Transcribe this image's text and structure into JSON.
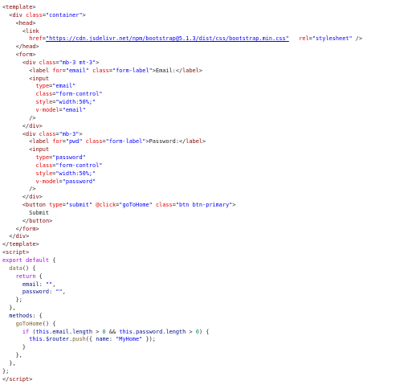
{
  "code_lines": [
    {
      "indent": 0,
      "tokens": [
        [
          "pun",
          "<"
        ],
        [
          "tag",
          "template"
        ],
        [
          "pun",
          ">"
        ]
      ]
    },
    {
      "indent": 1,
      "tokens": [
        [
          "pun",
          "<"
        ],
        [
          "tag",
          "div"
        ],
        [
          "pun",
          " "
        ],
        [
          "attr",
          "class"
        ],
        [
          "pun",
          "="
        ],
        [
          "str",
          "\"container\""
        ],
        [
          "pun",
          ">"
        ]
      ]
    },
    {
      "indent": 2,
      "tokens": [
        [
          "pun",
          "<"
        ],
        [
          "tag",
          "head"
        ],
        [
          "pun",
          ">"
        ]
      ]
    },
    {
      "indent": 3,
      "tokens": [
        [
          "pun",
          "<"
        ],
        [
          "tag",
          "link"
        ]
      ]
    },
    {
      "indent": 4,
      "tokens": [
        [
          "attr",
          "href"
        ],
        [
          "pun",
          "="
        ],
        [
          "url",
          "\"https://cdn.jsdelivr.net/npm/bootstrap@5.1.3/dist/css/bootstrap.min.css\""
        ],
        [
          "pun",
          "   "
        ],
        [
          "attr",
          "rel"
        ],
        [
          "pun",
          "="
        ],
        [
          "str",
          "\"stylesheet\""
        ],
        [
          "pun",
          " />"
        ]
      ]
    },
    {
      "indent": 2,
      "tokens": [
        [
          "pun",
          "</"
        ],
        [
          "tag",
          "head"
        ],
        [
          "pun",
          ">"
        ]
      ]
    },
    {
      "indent": 2,
      "tokens": [
        [
          "pun",
          "<"
        ],
        [
          "tag",
          "form"
        ],
        [
          "pun",
          ">"
        ]
      ]
    },
    {
      "indent": 3,
      "tokens": [
        [
          "pun",
          "<"
        ],
        [
          "tag",
          "div"
        ],
        [
          "pun",
          " "
        ],
        [
          "attr",
          "class"
        ],
        [
          "pun",
          "="
        ],
        [
          "str",
          "\"mb-3 mt-3\""
        ],
        [
          "pun",
          ">"
        ]
      ]
    },
    {
      "indent": 4,
      "tokens": [
        [
          "pun",
          "<"
        ],
        [
          "tag",
          "label"
        ],
        [
          "pun",
          " "
        ],
        [
          "attr",
          "for"
        ],
        [
          "pun",
          "="
        ],
        [
          "str",
          "\"email\""
        ],
        [
          "pun",
          " "
        ],
        [
          "attr",
          "class"
        ],
        [
          "pun",
          "="
        ],
        [
          "str",
          "\"form-label\""
        ],
        [
          "pun",
          ">"
        ],
        [
          "txt",
          "Email:"
        ],
        [
          "pun",
          "</"
        ],
        [
          "tag",
          "label"
        ],
        [
          "pun",
          ">"
        ]
      ]
    },
    {
      "indent": 4,
      "tokens": [
        [
          "pun",
          "<"
        ],
        [
          "tag",
          "input"
        ]
      ]
    },
    {
      "indent": 5,
      "tokens": [
        [
          "attr",
          "type"
        ],
        [
          "pun",
          "="
        ],
        [
          "str",
          "\"email\""
        ]
      ]
    },
    {
      "indent": 5,
      "tokens": [
        [
          "attr",
          "class"
        ],
        [
          "pun",
          "="
        ],
        [
          "str",
          "\"form-control\""
        ]
      ]
    },
    {
      "indent": 5,
      "tokens": [
        [
          "attr",
          "style"
        ],
        [
          "pun",
          "="
        ],
        [
          "str",
          "\"width:50%;\""
        ]
      ]
    },
    {
      "indent": 5,
      "tokens": [
        [
          "attr",
          "v-model"
        ],
        [
          "pun",
          "="
        ],
        [
          "str",
          "\"email\""
        ]
      ]
    },
    {
      "indent": 4,
      "tokens": [
        [
          "pun",
          "/>"
        ]
      ]
    },
    {
      "indent": 3,
      "tokens": [
        [
          "pun",
          "</"
        ],
        [
          "tag",
          "div"
        ],
        [
          "pun",
          ">"
        ]
      ]
    },
    {
      "indent": 3,
      "tokens": [
        [
          "pun",
          "<"
        ],
        [
          "tag",
          "div"
        ],
        [
          "pun",
          " "
        ],
        [
          "attr",
          "class"
        ],
        [
          "pun",
          "="
        ],
        [
          "str",
          "\"mb-3\""
        ],
        [
          "pun",
          ">"
        ]
      ]
    },
    {
      "indent": 4,
      "tokens": [
        [
          "pun",
          "<"
        ],
        [
          "tag",
          "label"
        ],
        [
          "pun",
          " "
        ],
        [
          "attr",
          "for"
        ],
        [
          "pun",
          "="
        ],
        [
          "str",
          "\"pwd\""
        ],
        [
          "pun",
          " "
        ],
        [
          "attr",
          "class"
        ],
        [
          "pun",
          "="
        ],
        [
          "str",
          "\"form-label\""
        ],
        [
          "pun",
          ">"
        ],
        [
          "txt",
          "Password:"
        ],
        [
          "pun",
          "</"
        ],
        [
          "tag",
          "label"
        ],
        [
          "pun",
          ">"
        ]
      ]
    },
    {
      "indent": 4,
      "tokens": [
        [
          "pun",
          "<"
        ],
        [
          "tag",
          "input"
        ]
      ]
    },
    {
      "indent": 5,
      "tokens": [
        [
          "attr",
          "type"
        ],
        [
          "pun",
          "="
        ],
        [
          "str",
          "\"password\""
        ]
      ]
    },
    {
      "indent": 5,
      "tokens": [
        [
          "attr",
          "class"
        ],
        [
          "pun",
          "="
        ],
        [
          "str",
          "\"form-control\""
        ]
      ]
    },
    {
      "indent": 5,
      "tokens": [
        [
          "attr",
          "style"
        ],
        [
          "pun",
          "="
        ],
        [
          "str",
          "\"width:50%;\""
        ]
      ],
      "highlight": true
    },
    {
      "indent": 5,
      "tokens": [
        [
          "attr",
          "v-model"
        ],
        [
          "pun",
          "="
        ],
        [
          "str",
          "\"password\""
        ]
      ]
    },
    {
      "indent": 4,
      "tokens": [
        [
          "pun",
          "/>"
        ]
      ]
    },
    {
      "indent": 3,
      "tokens": [
        [
          "pun",
          "</"
        ],
        [
          "tag",
          "div"
        ],
        [
          "pun",
          ">"
        ]
      ]
    },
    {
      "indent": 3,
      "tokens": [
        [
          "pun",
          "<"
        ],
        [
          "tag",
          "button"
        ],
        [
          "pun",
          " "
        ],
        [
          "attr",
          "type"
        ],
        [
          "pun",
          "="
        ],
        [
          "str",
          "\"submit\""
        ],
        [
          "pun",
          " "
        ],
        [
          "attr",
          "@click"
        ],
        [
          "pun",
          "="
        ],
        [
          "str",
          "\"goToHome\""
        ],
        [
          "pun",
          " "
        ],
        [
          "attr",
          "class"
        ],
        [
          "pun",
          "="
        ],
        [
          "str",
          "\"btn btn-primary\""
        ],
        [
          "pun",
          ">"
        ]
      ]
    },
    {
      "indent": 4,
      "tokens": [
        [
          "txt",
          "Submit"
        ]
      ]
    },
    {
      "indent": 3,
      "tokens": [
        [
          "pun",
          "</"
        ],
        [
          "tag",
          "button"
        ],
        [
          "pun",
          ">"
        ]
      ]
    },
    {
      "indent": 2,
      "tokens": [
        [
          "pun",
          "</"
        ],
        [
          "tag",
          "form"
        ],
        [
          "pun",
          ">"
        ]
      ]
    },
    {
      "indent": 1,
      "tokens": [
        [
          "pun",
          "</"
        ],
        [
          "tag",
          "div"
        ],
        [
          "pun",
          ">"
        ]
      ]
    },
    {
      "indent": 0,
      "tokens": [
        [
          "pun",
          "</"
        ],
        [
          "tag",
          "template"
        ],
        [
          "pun",
          ">"
        ]
      ]
    },
    {
      "indent": 0,
      "tokens": [
        [
          "pun",
          "<"
        ],
        [
          "tag",
          "script"
        ],
        [
          "pun",
          ">"
        ]
      ]
    },
    {
      "indent": 0,
      "tokens": [
        [
          "kw2",
          "export"
        ],
        [
          "pun",
          " "
        ],
        [
          "kw2",
          "default"
        ],
        [
          "pun",
          " {"
        ]
      ]
    },
    {
      "indent": 1,
      "tokens": [
        [
          "fn",
          "data"
        ],
        [
          "pun",
          "() {"
        ]
      ]
    },
    {
      "indent": 2,
      "tokens": [
        [
          "kw2",
          "return"
        ],
        [
          "pun",
          " {"
        ]
      ]
    },
    {
      "indent": 3,
      "tokens": [
        [
          "var",
          "email"
        ],
        [
          "pun",
          ": "
        ],
        [
          "str",
          "\"\""
        ],
        [
          "pun",
          ","
        ]
      ]
    },
    {
      "indent": 3,
      "tokens": [
        [
          "var",
          "password"
        ],
        [
          "pun",
          ": "
        ],
        [
          "str",
          "\"\""
        ],
        [
          "pun",
          ","
        ]
      ]
    },
    {
      "indent": 2,
      "tokens": [
        [
          "pun",
          "};"
        ]
      ]
    },
    {
      "indent": 1,
      "tokens": [
        [
          "pun",
          "},"
        ]
      ]
    },
    {
      "indent": 1,
      "tokens": [
        [
          "var",
          "methods"
        ],
        [
          "pun",
          ": {"
        ]
      ]
    },
    {
      "indent": 2,
      "tokens": [
        [
          "fn",
          "goToHome"
        ],
        [
          "pun",
          "() {"
        ]
      ]
    },
    {
      "indent": 3,
      "tokens": [
        [
          "kw2",
          "if"
        ],
        [
          "pun",
          " ("
        ],
        [
          "kw",
          "this"
        ],
        [
          "pun",
          "."
        ],
        [
          "var",
          "email"
        ],
        [
          "pun",
          "."
        ],
        [
          "var",
          "length"
        ],
        [
          "pun",
          " > "
        ],
        [
          "num",
          "0"
        ],
        [
          "pun",
          " && "
        ],
        [
          "kw",
          "this"
        ],
        [
          "pun",
          "."
        ],
        [
          "var",
          "password"
        ],
        [
          "pun",
          "."
        ],
        [
          "var",
          "length"
        ],
        [
          "pun",
          " > "
        ],
        [
          "num",
          "0"
        ],
        [
          "pun",
          ") {"
        ]
      ]
    },
    {
      "indent": 4,
      "tokens": [
        [
          "kw",
          "this"
        ],
        [
          "pun",
          "."
        ],
        [
          "var",
          "$router"
        ],
        [
          "pun",
          "."
        ],
        [
          "fn",
          "push"
        ],
        [
          "pun",
          "({ "
        ],
        [
          "var",
          "name"
        ],
        [
          "pun",
          ": "
        ],
        [
          "str",
          "\"MyHome\""
        ],
        [
          "pun",
          " });"
        ]
      ]
    },
    {
      "indent": 3,
      "tokens": [
        [
          "pun",
          "}"
        ]
      ]
    },
    {
      "indent": 2,
      "tokens": [
        [
          "pun",
          "},"
        ]
      ]
    },
    {
      "indent": 1,
      "tokens": [
        [
          "pun",
          "},"
        ]
      ]
    },
    {
      "indent": 0,
      "tokens": [
        [
          "pun",
          "};"
        ]
      ]
    },
    {
      "indent": 0,
      "tokens": [
        [
          "pun",
          "</"
        ],
        [
          "tag",
          "script"
        ],
        [
          "pun",
          ">"
        ]
      ]
    }
  ]
}
